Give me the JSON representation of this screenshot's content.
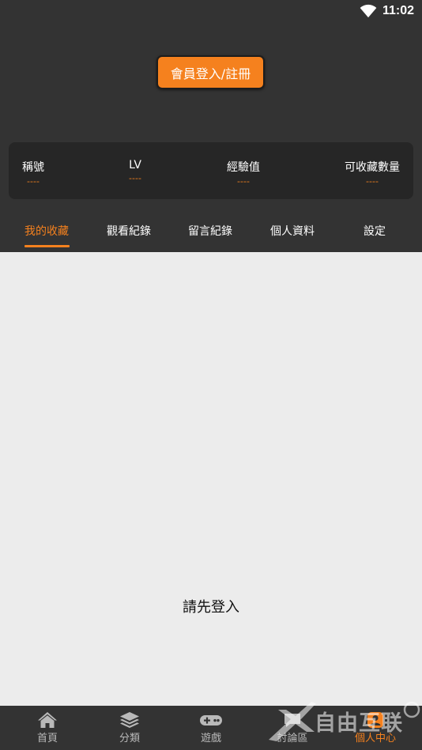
{
  "status_bar": {
    "time": "11:02",
    "wifi_icon": "wifi-icon"
  },
  "header": {
    "login_button": "會員登入/註冊"
  },
  "stats": [
    {
      "label": "稱號",
      "value": "----"
    },
    {
      "label": "LV",
      "value": "----"
    },
    {
      "label": "經驗值",
      "value": "----"
    },
    {
      "label": "可收藏數量",
      "value": "----"
    }
  ],
  "tabs": [
    {
      "label": "我的收藏",
      "active": true
    },
    {
      "label": "觀看紀錄",
      "active": false
    },
    {
      "label": "留言紀錄",
      "active": false
    },
    {
      "label": "個人資料",
      "active": false
    },
    {
      "label": "設定",
      "active": false
    }
  ],
  "content": {
    "empty_message": "請先登入"
  },
  "bottom_nav": [
    {
      "label": "首頁",
      "icon": "home-icon",
      "active": false
    },
    {
      "label": "分類",
      "icon": "layers-icon",
      "active": false
    },
    {
      "label": "遊戲",
      "icon": "gamepad-icon",
      "active": false
    },
    {
      "label": "討論區",
      "icon": "chat-icon",
      "active": false
    },
    {
      "label": "個人中心",
      "icon": "user-icon",
      "active": true
    }
  ],
  "watermark": "自由互联",
  "colors": {
    "accent": "#f5811e",
    "header_bg": "#333333",
    "stats_bg": "#262626",
    "content_bg": "#ececec"
  }
}
